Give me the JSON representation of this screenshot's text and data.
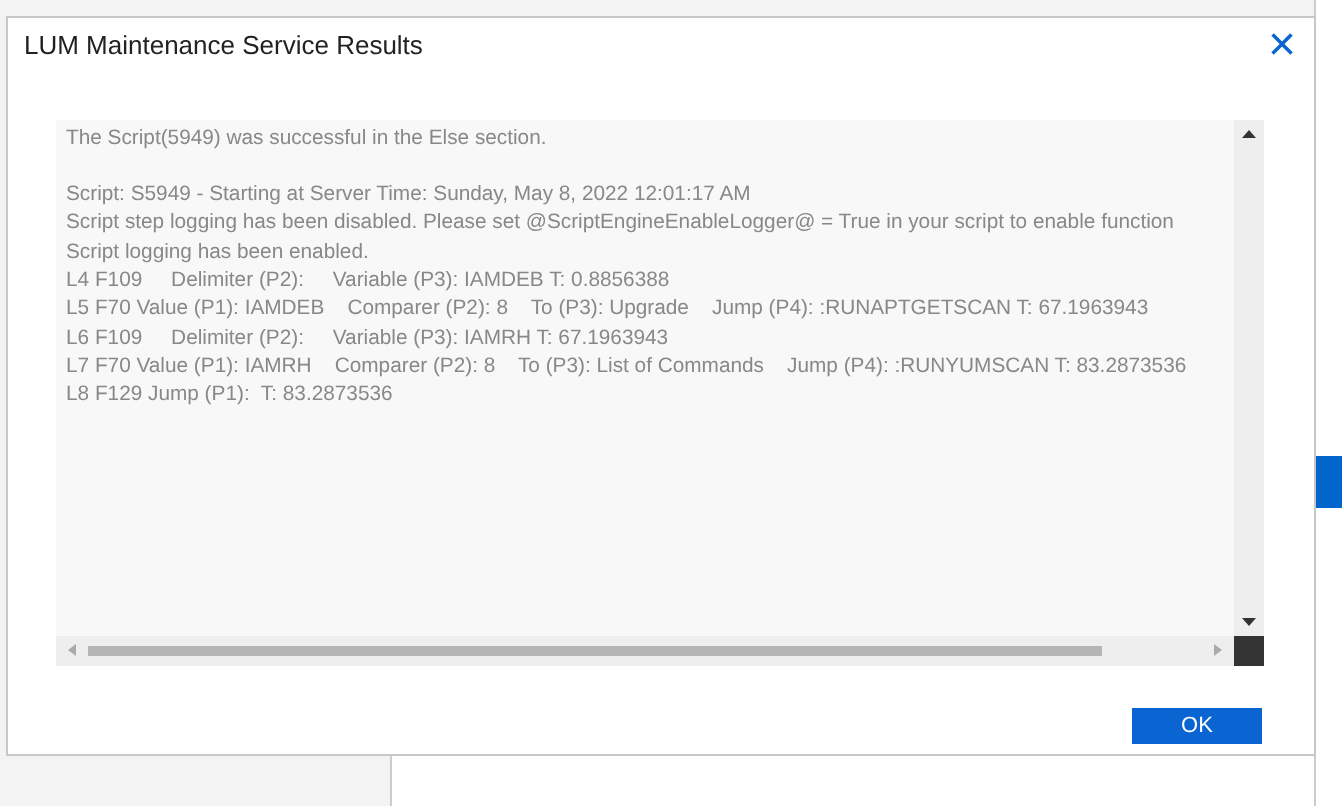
{
  "dialog": {
    "title": "LUM Maintenance Service Results",
    "close": "×"
  },
  "log": {
    "summary": "The Script(5949) was successful in the Else section.",
    "lines": [
      "Script: S5949 - Starting at Server Time: Sunday, May 8, 2022 12:01:17 AM",
      "Script step logging has been disabled. Please set @ScriptEngineEnableLogger@ = True in your script to enable function",
      "Script logging has been enabled.",
      "L4 F109     Delimiter (P2):     Variable (P3): IAMDEB T: 0.8856388",
      "L5 F70 Value (P1): IAMDEB    Comparer (P2): 8    To (P3): Upgrade    Jump (P4): :RUNAPTGETSCAN T: 67.1963943",
      "L6 F109     Delimiter (P2):     Variable (P3): IAMRH T: 67.1963943",
      "L7 F70 Value (P1): IAMRH    Comparer (P2): 8    To (P3): List of Commands    Jump (P4): :RUNYUMSCAN T: 83.2873536",
      "L8 F129 Jump (P1):  T: 83.2873536"
    ]
  },
  "buttons": [
    {
      "label": "OK",
      "kind": "primary"
    }
  ]
}
